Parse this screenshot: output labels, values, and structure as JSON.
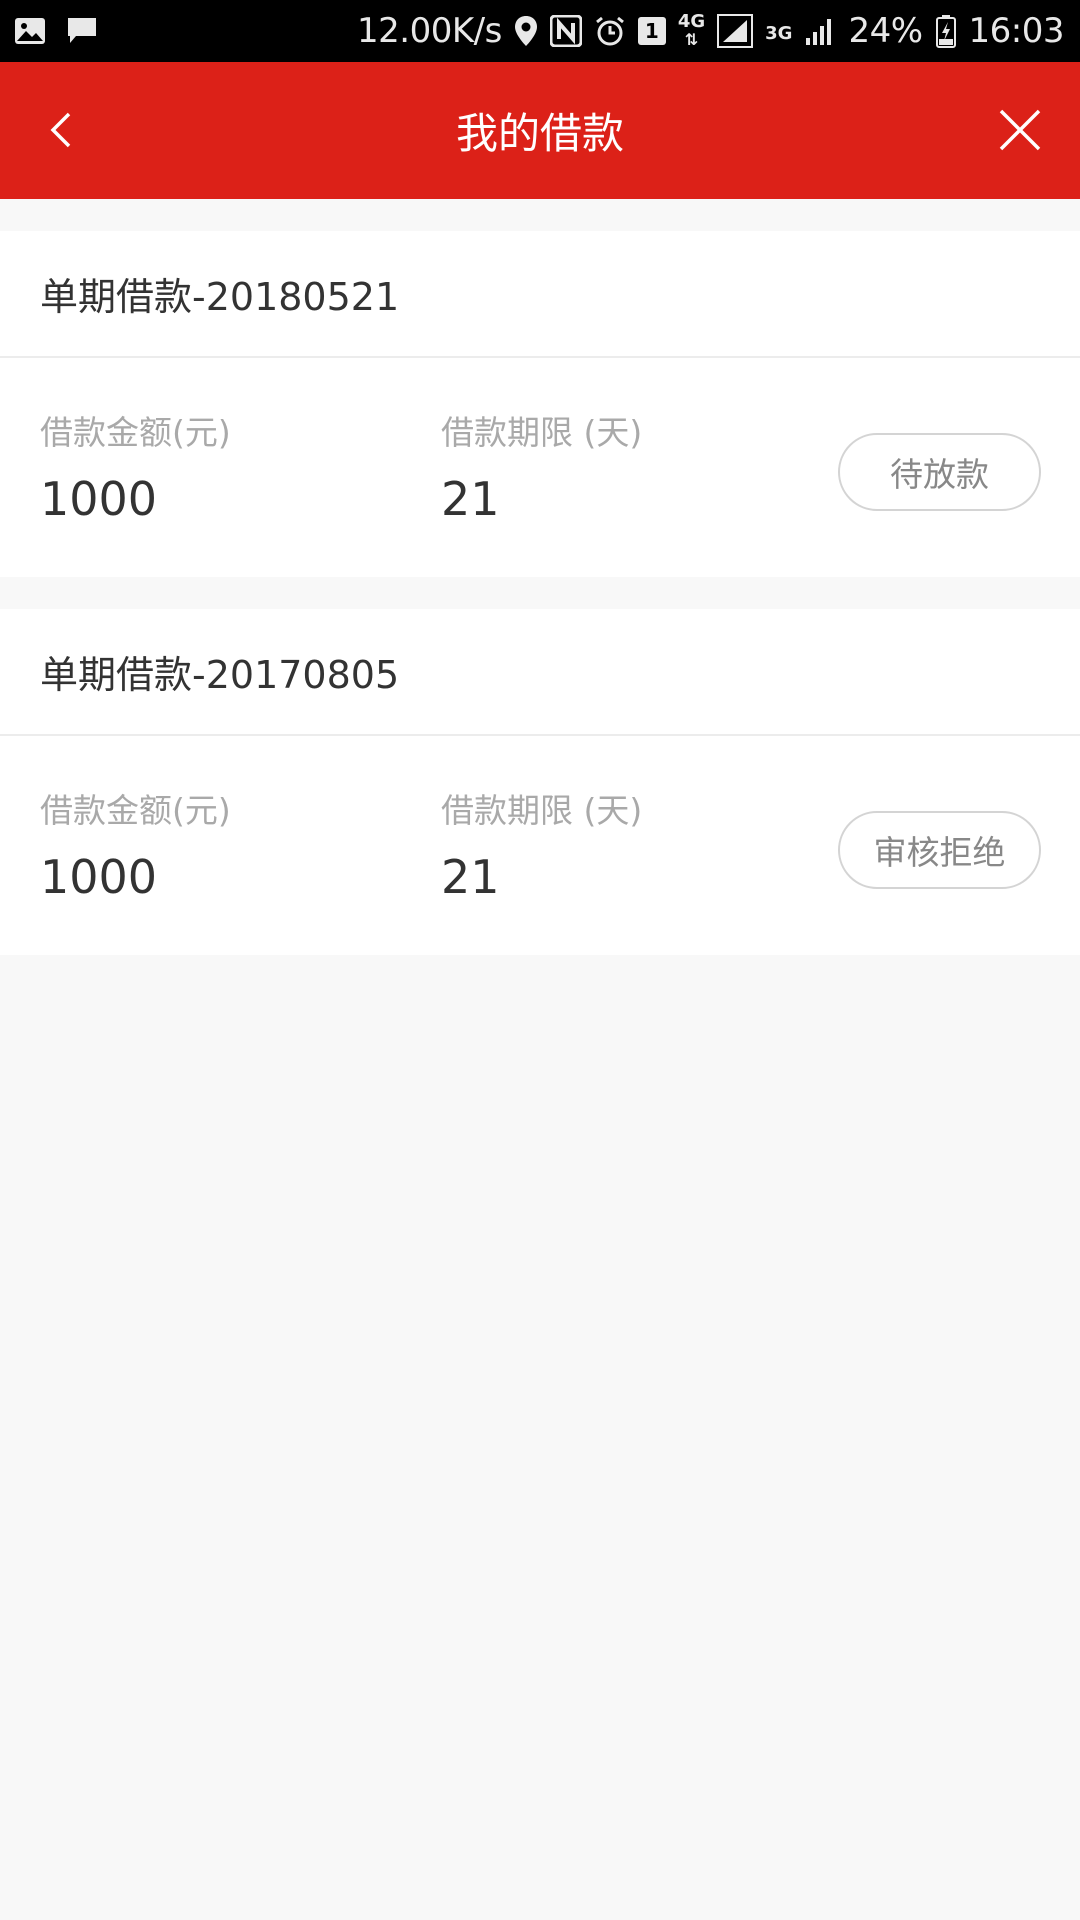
{
  "status_bar": {
    "speed": "12.00K/s",
    "sim_badge": "1",
    "net_4g": "4G",
    "net_3g": "3G",
    "battery": "24%",
    "time": "16:03"
  },
  "header": {
    "title": "我的借款",
    "back_icon": "chevron-left-icon",
    "close_icon": "close-icon"
  },
  "loans": [
    {
      "name": "单期借款-20180521",
      "amount_label": "借款金额(元)",
      "amount": "1000",
      "term_label": "借款期限 (天)",
      "term": "21",
      "status": "待放款"
    },
    {
      "name": "单期借款-20170805",
      "amount_label": "借款金额(元)",
      "amount": "1000",
      "term_label": "借款期限 (天)",
      "term": "21",
      "status": "审核拒绝"
    }
  ],
  "colors": {
    "brand_red": "#dc2118",
    "background": "#f8f8f8"
  }
}
